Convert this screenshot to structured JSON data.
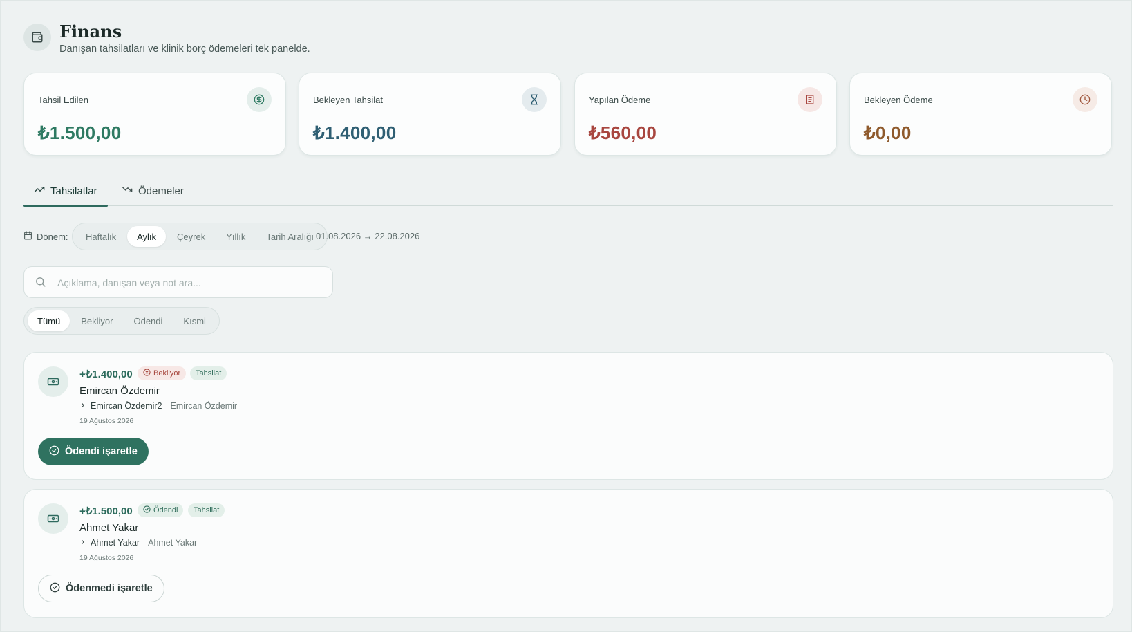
{
  "header": {
    "icon": "wallet-icon",
    "title": "Finans",
    "subtitle": "Danışan tahsilatları ve klinik borç ödemeleri tek panelde."
  },
  "stats": [
    {
      "label": "Tahsil Edilen",
      "value": "₺1.500,00",
      "icon": "dollar-circle-icon",
      "color": "#2e7a62"
    },
    {
      "label": "Bekleyen Tahsilat",
      "value": "₺1.400,00",
      "icon": "hourglass-icon",
      "color": "#2f5f73"
    },
    {
      "label": "Yapılan Ödeme",
      "value": "₺560,00",
      "icon": "receipt-icon",
      "color": "#a8463f"
    },
    {
      "label": "Bekleyen Ödeme",
      "value": "₺0,00",
      "icon": "clock-icon",
      "color": "#8f5a2c"
    }
  ],
  "tabs": [
    {
      "label": "Tahsilatlar",
      "icon": "trending-up-icon",
      "active": true
    },
    {
      "label": "Ödemeler",
      "icon": "trending-down-icon",
      "active": false
    }
  ],
  "period": {
    "label": "Dönem:",
    "options": [
      "Haftalık",
      "Aylık",
      "Çeyrek",
      "Yıllık",
      "Tarih Aralığı"
    ],
    "selected": "Aylık",
    "range": "01.08.2026 → 22.08.2026"
  },
  "search": {
    "placeholder": "Açıklama, danışan veya not ara...",
    "value": ""
  },
  "status_filter": {
    "options": [
      "Tümü",
      "Bekliyor",
      "Ödendi",
      "Kısmi"
    ],
    "selected": "Tümü"
  },
  "transactions": [
    {
      "amount": "+₺1.400,00",
      "status": "Bekliyor",
      "type": "Tahsilat",
      "name": "Emircan Özdemir",
      "sub_name": "Emircan Özdemir2",
      "client": "Emircan Özdemir",
      "date": "19 Ağustos 2026",
      "action": "Ödendi işaretle"
    },
    {
      "amount": "+₺1.500,00",
      "status": "Ödendi",
      "type": "Tahsilat",
      "name": "Ahmet Yakar",
      "sub_name": "Ahmet Yakar",
      "client": "Ahmet Yakar",
      "date": "19 Ağustos 2026",
      "action": "Ödenmedi işaretle"
    }
  ],
  "colors": {
    "accent": "#2f7260",
    "background": "#eef2f2",
    "pending": "#a6453c",
    "paid": "#2d6b58"
  }
}
